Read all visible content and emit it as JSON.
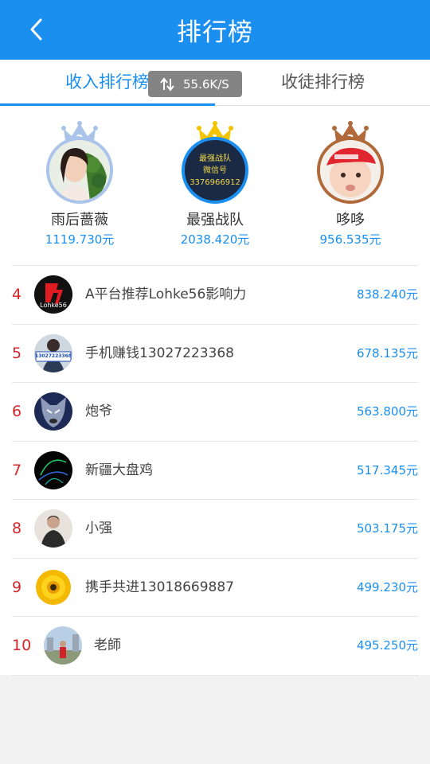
{
  "header": {
    "title": "排行榜",
    "back_icon": "chevron-left-icon"
  },
  "tabs": [
    {
      "label": "收入排行榜",
      "active": true
    },
    {
      "label": "收徒排行榜",
      "active": false
    }
  ],
  "speed_overlay": {
    "icon": "transfer-arrows-icon",
    "text": "55.6K/S"
  },
  "podium": [
    {
      "rank": "2",
      "name": "雨后蔷薇",
      "amount": "1119.730元",
      "crown_color": "#a9c4e8",
      "ring_color": "#a9c4e8"
    },
    {
      "rank": "1",
      "name": "最强战队",
      "amount": "2038.420元",
      "crown_color": "#f5c400",
      "ring_color": "#1a8ff0",
      "avatar_text": [
        "最强战队",
        "微信号",
        "3376966912"
      ]
    },
    {
      "rank": "3",
      "name": "哆哆",
      "amount": "956.535元",
      "crown_color": "#b06a3a",
      "ring_color": "#b06a3a"
    }
  ],
  "rows": [
    {
      "rank": "4",
      "name": "A平台推荐Lohke56影响力",
      "amount": "838.240元",
      "avatar_text": "Lohke56"
    },
    {
      "rank": "5",
      "name": "手机赚钱13027223368",
      "amount": "678.135元",
      "avatar_text": "13027223368"
    },
    {
      "rank": "6",
      "name": "炮爷",
      "amount": "563.800元"
    },
    {
      "rank": "7",
      "name": "新疆大盘鸡",
      "amount": "517.345元"
    },
    {
      "rank": "8",
      "name": "小强",
      "amount": "503.175元"
    },
    {
      "rank": "9",
      "name": "携手共进13018669887",
      "amount": "499.230元"
    },
    {
      "rank": "10",
      "name": "老師",
      "amount": "495.250元"
    }
  ]
}
